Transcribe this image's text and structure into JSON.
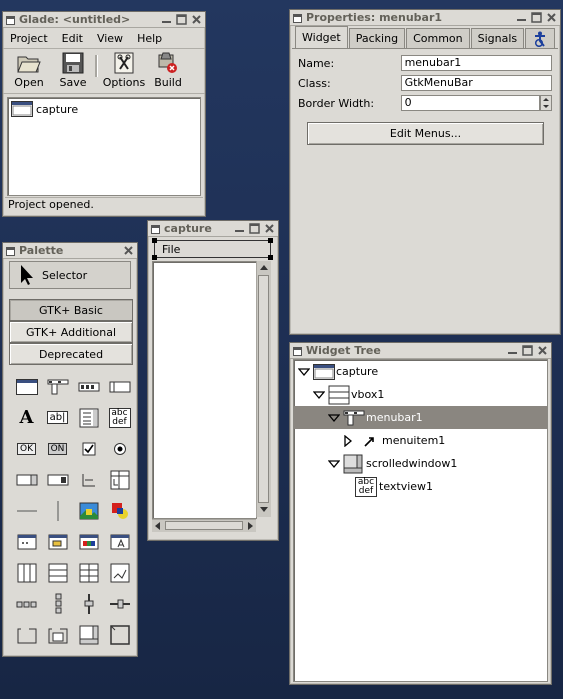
{
  "colors": {
    "desktop": "#1f3157",
    "window": "#dcdad5",
    "selection": "#8a8680",
    "title_text": "#636159"
  },
  "glade": {
    "title": "Glade: <untitled>",
    "menu": [
      {
        "label": "Project"
      },
      {
        "label": "Edit"
      },
      {
        "label": "View"
      },
      {
        "label": "Help"
      }
    ],
    "toolbar": [
      {
        "label": "Open",
        "icon": "folder-open-icon"
      },
      {
        "label": "Save",
        "icon": "floppy-disk-icon"
      },
      {
        "label": "Options",
        "icon": "options-tools-icon"
      },
      {
        "label": "Build",
        "icon": "build-icon"
      }
    ],
    "project_item": "capture",
    "status": "Project opened."
  },
  "properties": {
    "title": "Properties: menubar1",
    "tabs": [
      "Widget",
      "Packing",
      "Common",
      "Signals"
    ],
    "accessibility_tab_icon": "accessibility-icon",
    "name_label": "Name:",
    "name_value": "menubar1",
    "class_label": "Class:",
    "class_value": "GtkMenuBar",
    "border_label": "Border Width:",
    "border_value": "0",
    "edit_menus_label": "Edit Menus..."
  },
  "capture": {
    "title": "capture",
    "menu_item": "File"
  },
  "palette": {
    "title": "Palette",
    "selector_label": "Selector",
    "sections": [
      "GTK+ Basic",
      "GTK+ Additional",
      "Deprecated"
    ],
    "active_section": "GTK+ Basic",
    "icon_text": {
      "label_a": "A",
      "entry": "ab|",
      "textview": "abc def",
      "ok": "OK",
      "toggle": "ON"
    }
  },
  "widget_tree": {
    "title": "Widget Tree",
    "nodes": [
      {
        "label": "capture",
        "icon": "window-icon"
      },
      {
        "label": "vbox1",
        "icon": "vbox-icon"
      },
      {
        "label": "menubar1",
        "icon": "menubar-icon"
      },
      {
        "label": "menuitem1",
        "icon": "menuitem-icon"
      },
      {
        "label": "scrolledwindow1",
        "icon": "scrolledwindow-icon"
      },
      {
        "label": "textview1",
        "icon": "textview-icon"
      }
    ],
    "selected": "menubar1",
    "textview_icon_text": "abc def"
  }
}
